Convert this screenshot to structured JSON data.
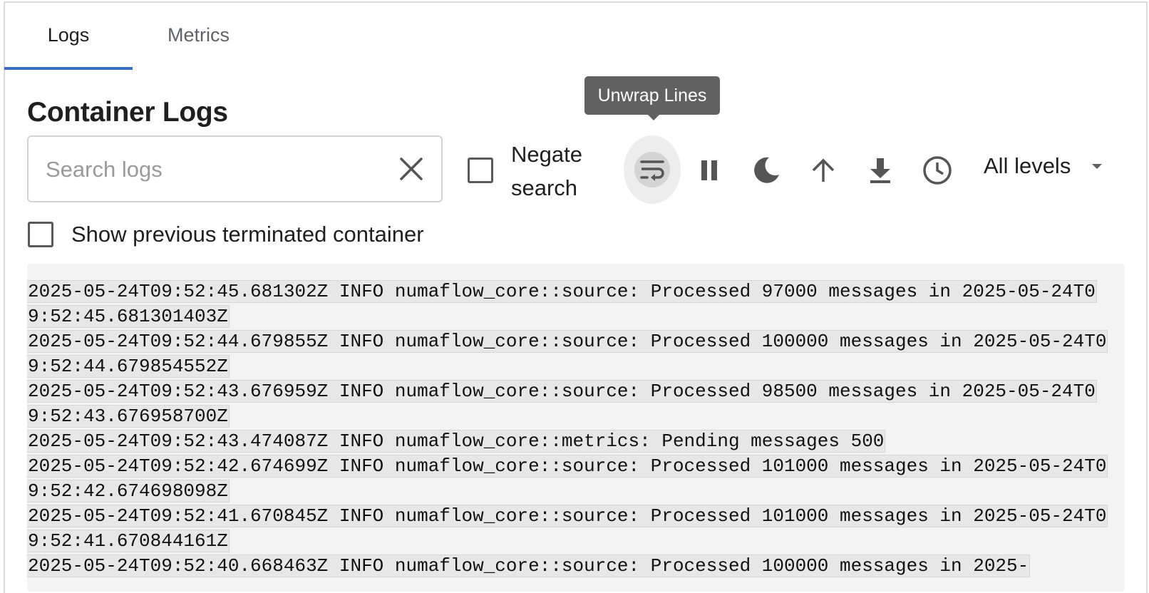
{
  "tabs": [
    {
      "label": "Logs",
      "active": true
    },
    {
      "label": "Metrics",
      "active": false
    }
  ],
  "section_title": "Container Logs",
  "search": {
    "placeholder": "Search logs",
    "value": ""
  },
  "negate_search": {
    "label": "Negate search",
    "checked": false
  },
  "show_previous": {
    "label": "Show previous terminated container",
    "checked": false
  },
  "toolbar": {
    "icons": [
      "wrap-lines-icon",
      "pause-icon",
      "dark-mode-icon",
      "arrow-up-icon",
      "download-icon",
      "clock-icon"
    ],
    "tooltip": "Unwrap Lines",
    "level_select": "All levels"
  },
  "logs": [
    "2025-05-24T09:52:45.681302Z INFO numaflow_core::source: Processed 97000 messages in 2025-05-24T09:52:45.681301403Z",
    "2025-05-24T09:52:44.679855Z INFO numaflow_core::source: Processed 100000 messages in 2025-05-24T09:52:44.679854552Z",
    "2025-05-24T09:52:43.676959Z INFO numaflow_core::source: Processed 98500 messages in 2025-05-24T09:52:43.676958700Z",
    "2025-05-24T09:52:43.474087Z INFO numaflow_core::metrics: Pending messages 500",
    "2025-05-24T09:52:42.674699Z INFO numaflow_core::source: Processed 101000 messages in 2025-05-24T09:52:42.674698098Z",
    "2025-05-24T09:52:41.670845Z INFO numaflow_core::source: Processed 101000 messages in 2025-05-24T09:52:41.670844161Z",
    "2025-05-24T09:52:40.668463Z INFO numaflow_core::source: Processed 100000 messages in 2025-"
  ],
  "colors": {
    "accent": "#3b6fc4",
    "tooltip_bg": "#616161",
    "log_bg": "#f3f3f3"
  }
}
